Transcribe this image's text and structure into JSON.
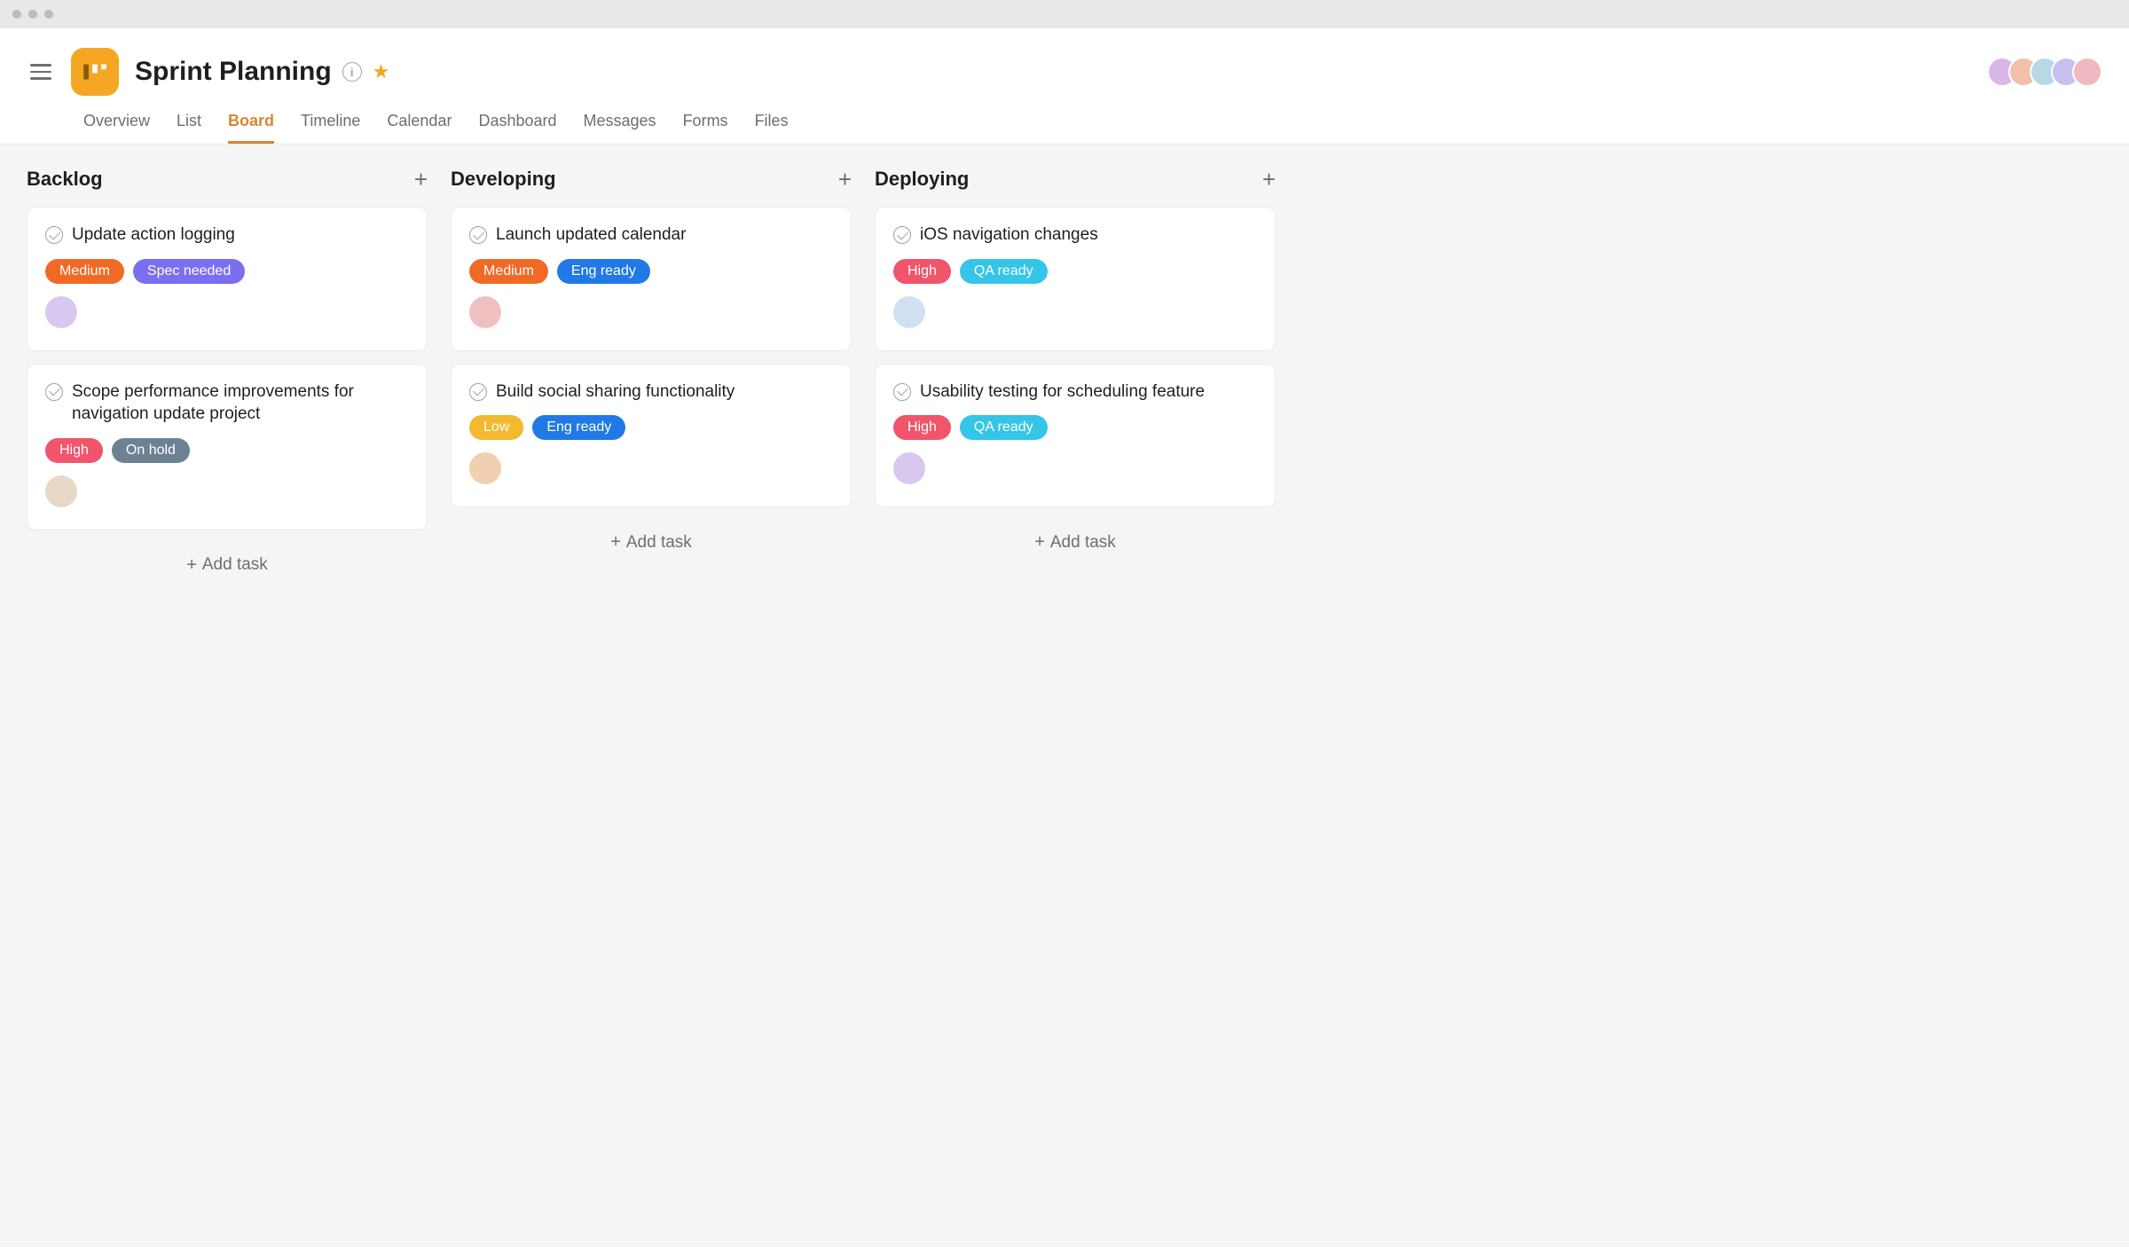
{
  "project": {
    "title": "Sprint Planning"
  },
  "tabs": [
    {
      "label": "Overview",
      "active": false
    },
    {
      "label": "List",
      "active": false
    },
    {
      "label": "Board",
      "active": true
    },
    {
      "label": "Timeline",
      "active": false
    },
    {
      "label": "Calendar",
      "active": false
    },
    {
      "label": "Dashboard",
      "active": false
    },
    {
      "label": "Messages",
      "active": false
    },
    {
      "label": "Forms",
      "active": false
    },
    {
      "label": "Files",
      "active": false
    }
  ],
  "header_avatars": [
    {
      "bg": "#d9b8e8"
    },
    {
      "bg": "#f0c0a8"
    },
    {
      "bg": "#b8d8e8"
    },
    {
      "bg": "#c8c0f0"
    },
    {
      "bg": "#f0b8c0"
    }
  ],
  "columns": [
    {
      "title": "Backlog",
      "add_label": "Add task",
      "cards": [
        {
          "title": "Update action logging",
          "tags": [
            {
              "label": "Medium",
              "cls": "tag-medium"
            },
            {
              "label": "Spec needed",
              "cls": "tag-spec"
            }
          ],
          "assignee_bg": "#d8c8f0"
        },
        {
          "title": "Scope performance improvements for navigation update project",
          "tags": [
            {
              "label": "High",
              "cls": "tag-high"
            },
            {
              "label": "On hold",
              "cls": "tag-onhold"
            }
          ],
          "assignee_bg": "#e8d8c8"
        }
      ]
    },
    {
      "title": "Developing",
      "add_label": "Add task",
      "cards": [
        {
          "title": "Launch updated calendar",
          "tags": [
            {
              "label": "Medium",
              "cls": "tag-medium"
            },
            {
              "label": "Eng ready",
              "cls": "tag-eng"
            }
          ],
          "assignee_bg": "#f0c0c0"
        },
        {
          "title": "Build social sharing functionality",
          "tags": [
            {
              "label": "Low",
              "cls": "tag-low"
            },
            {
              "label": "Eng ready",
              "cls": "tag-eng"
            }
          ],
          "assignee_bg": "#f0d0b0"
        }
      ]
    },
    {
      "title": "Deploying",
      "add_label": "Add task",
      "cards": [
        {
          "title": "iOS navigation changes",
          "tags": [
            {
              "label": "High",
              "cls": "tag-high"
            },
            {
              "label": "QA ready",
              "cls": "tag-qa"
            }
          ],
          "assignee_bg": "#d0e0f0"
        },
        {
          "title": "Usability testing for scheduling feature",
          "tags": [
            {
              "label": "High",
              "cls": "tag-high"
            },
            {
              "label": "QA ready",
              "cls": "tag-qa"
            }
          ],
          "assignee_bg": "#d8c8f0"
        }
      ]
    }
  ]
}
